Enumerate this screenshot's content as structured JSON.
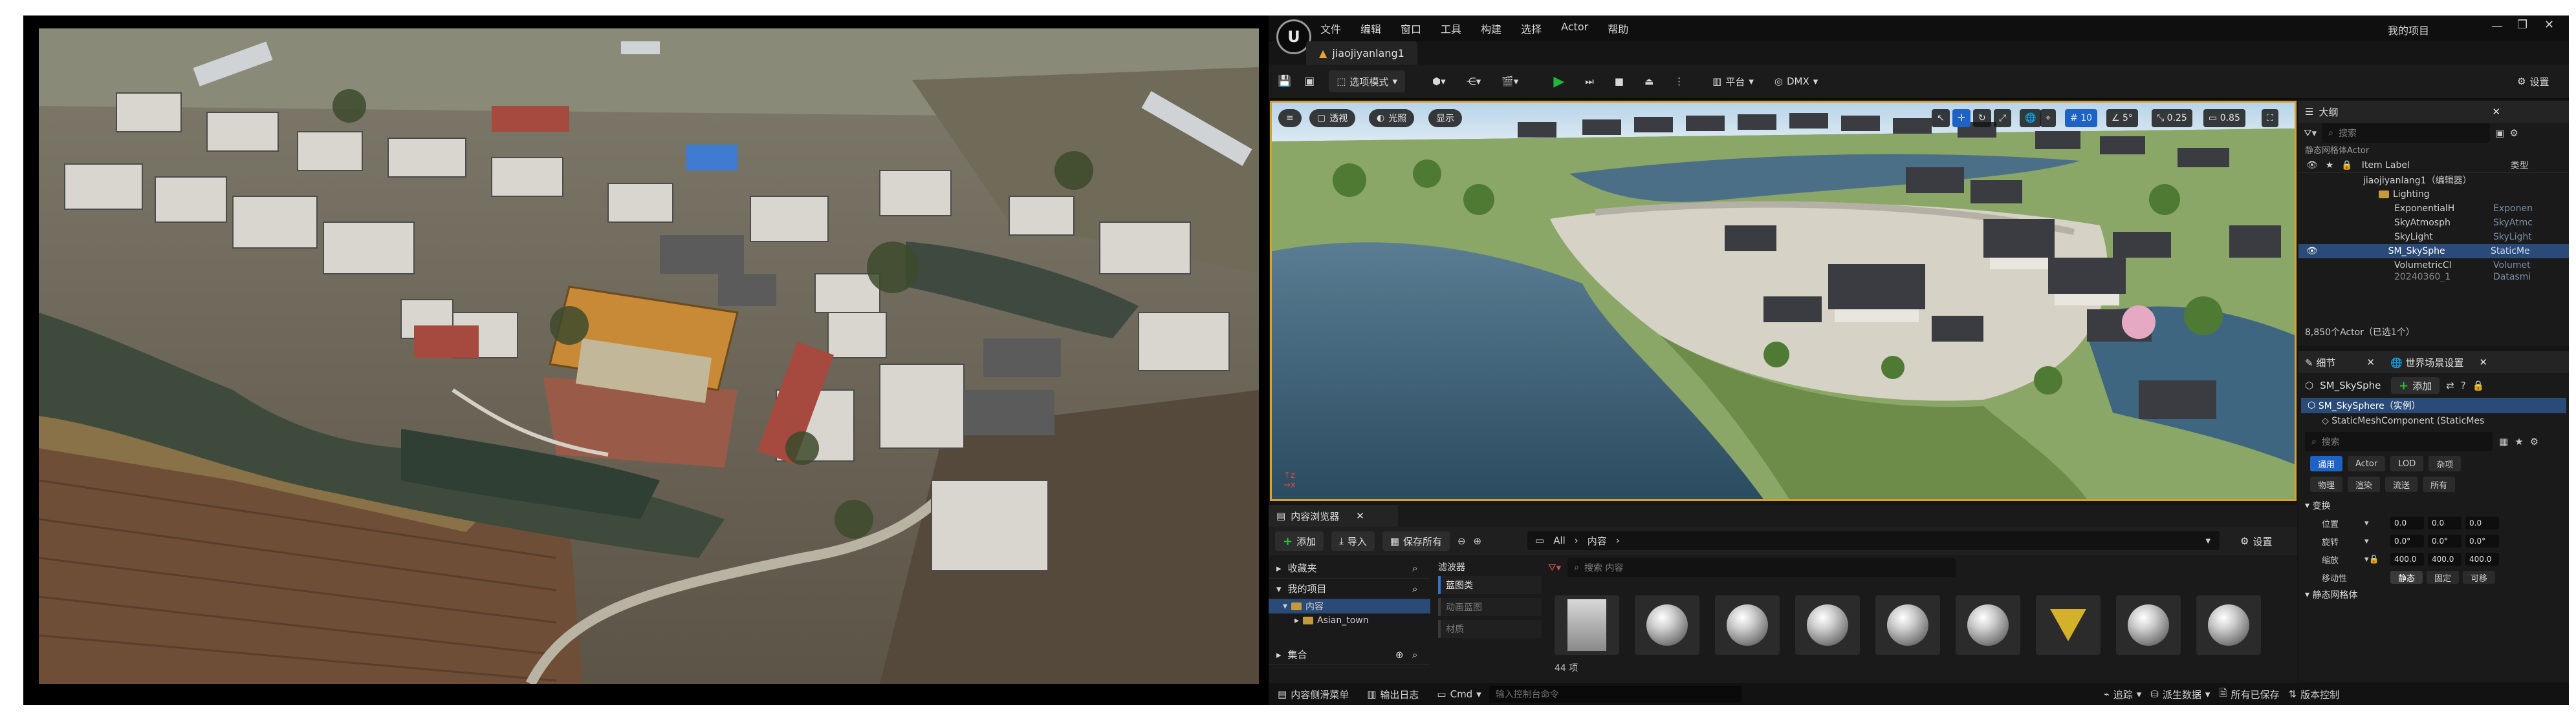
{
  "menu": [
    "文件",
    "编辑",
    "窗口",
    "工具",
    "构建",
    "选择",
    "Actor",
    "帮助"
  ],
  "project_name": "我的项目",
  "map_tab": "jiaojiyanlang1",
  "toolbar": {
    "mode": "选项模式",
    "platform": "平台",
    "dmx": "DMX",
    "settings": "设置"
  },
  "viewport": {
    "perspective": "透视",
    "lit": "光照",
    "show": "显示",
    "grid": "10",
    "angle": "5°",
    "scale": "0.25",
    "speed": "0.85"
  },
  "outliner": {
    "title": "大纲",
    "search_placeholder": "搜索",
    "filter_label": "静态网格体Actor",
    "col_label": "Item Label",
    "col_type": "类型",
    "rows": [
      {
        "label": "jiaojiyanlang1（编辑器）",
        "type": ""
      },
      {
        "label": "Lighting",
        "type": ""
      },
      {
        "label": "ExponentialH",
        "type": "Exponen"
      },
      {
        "label": "SkyAtmosph",
        "type": "SkyAtmc"
      },
      {
        "label": "SkyLight",
        "type": "SkyLight"
      },
      {
        "label": "SM_SkySphe",
        "type": "StaticMe"
      },
      {
        "label": "VolumetricCl",
        "type": "Volumet"
      },
      {
        "label": "20240360_1",
        "type": "Datasmi"
      }
    ],
    "summary": "8,850个Actor（已选1个）"
  },
  "details": {
    "tab1": "细节",
    "tab2": "世界场景设置",
    "actor": "SM_SkySphe",
    "add": "添加",
    "instance": "SM_SkySphere（实例）",
    "component": "StaticMeshComponent (StaticMes",
    "search_placeholder": "搜索",
    "filters1": [
      "通用",
      "Actor",
      "LOD",
      "杂项"
    ],
    "filters2": [
      "物理",
      "渲染",
      "流送",
      "所有"
    ],
    "section_transform": "变换",
    "location_label": "位置",
    "rotation_label": "旋转",
    "scale_label": "缩放",
    "location": [
      "0.0",
      "0.0",
      "0.0"
    ],
    "rotation": [
      "0.0°",
      "0.0°",
      "0.0°"
    ],
    "scale": [
      "400.0",
      "400.0",
      "400.0"
    ],
    "mobility_label": "移动性",
    "mobility": [
      "静态",
      "固定",
      "可移"
    ],
    "section_mesh": "静态网格体"
  },
  "content_browser": {
    "tab": "内容浏览器",
    "add": "添加",
    "import": "导入",
    "save_all": "保存所有",
    "path": [
      "All",
      "内容"
    ],
    "settings": "设置",
    "favorites": "收藏夹",
    "my_project": "我的项目",
    "content_folder": "内容",
    "asian_town": "Asian_town",
    "collections": "集合",
    "filters_title": "滤波器",
    "filter_items": [
      "蓝图类",
      "动画蓝图",
      "材质"
    ],
    "search_placeholder": "搜索 内容",
    "item_count": "44 项"
  },
  "status_bar": {
    "drawer": "内容侧滑菜单",
    "output_log": "输出日志",
    "cmd": "Cmd",
    "console_placeholder": "输入控制台命令",
    "trace": "追踪",
    "derived_data": "派生数据",
    "all_saved": "所有已保存",
    "source_control": "版本控制"
  }
}
